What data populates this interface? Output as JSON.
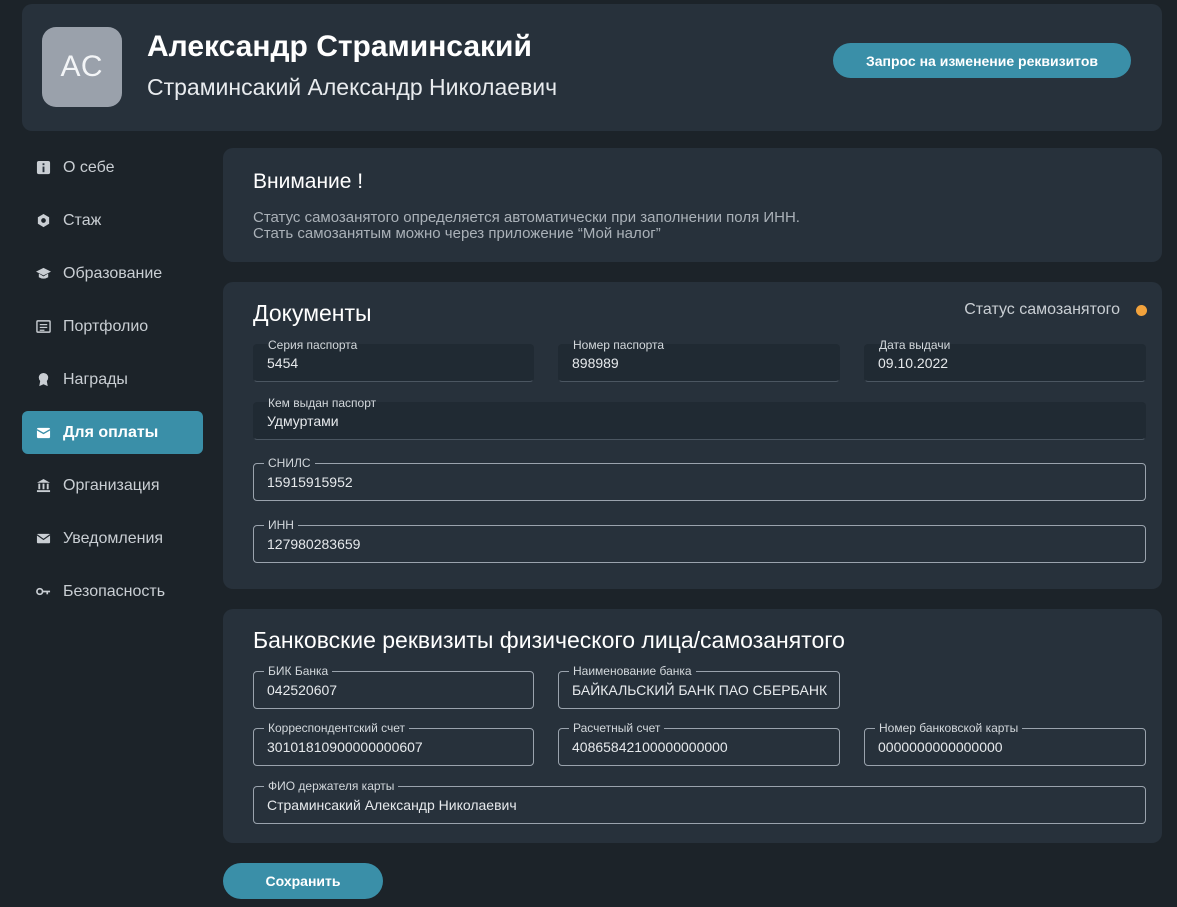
{
  "header": {
    "initials": "АС",
    "name": "Александр Страминсакий",
    "full_name": "Страминсакий Александр Николаевич",
    "request_button": "Запрос на изменение реквизитов"
  },
  "sidebar": {
    "items": [
      {
        "label": "О себе",
        "icon": "info-icon"
      },
      {
        "label": "Стаж",
        "icon": "hexagon-icon"
      },
      {
        "label": "Образование",
        "icon": "graduation-cap-icon"
      },
      {
        "label": "Портфолио",
        "icon": "document-icon"
      },
      {
        "label": "Награды",
        "icon": "award-icon"
      },
      {
        "label": "Для оплаты",
        "icon": "wallet-icon",
        "active": true
      },
      {
        "label": "Организация",
        "icon": "bank-icon"
      },
      {
        "label": "Уведомления",
        "icon": "envelope-icon"
      },
      {
        "label": "Безопасность",
        "icon": "key-icon"
      }
    ]
  },
  "notice": {
    "title": "Внимание !",
    "line1": "Статус самозанятого определяется автоматически при заполнении поля ИНН.",
    "line2": "Стать самозанятым можно через приложение “Мой налог”"
  },
  "documents": {
    "title": "Документы",
    "status_label": "Статус самозанятого",
    "status_color": "#f2a23c",
    "passport_series": {
      "label": "Серия паспорта",
      "value": "5454"
    },
    "passport_number": {
      "label": "Номер паспорта",
      "value": "898989"
    },
    "issue_date": {
      "label": "Дата выдачи",
      "value": "09.10.2022"
    },
    "issued_by": {
      "label": "Кем выдан паспорт",
      "value": "Удмуртами"
    },
    "snils": {
      "label": "СНИЛС",
      "value": "15915915952"
    },
    "inn": {
      "label": "ИНН",
      "value": "127980283659"
    }
  },
  "bank": {
    "title": "Банковские реквизиты физического лица/самозанятого",
    "bik": {
      "label": "БИК Банка",
      "value": "042520607"
    },
    "bank_name": {
      "label": "Наименование банка",
      "value": "БАЙКАЛЬСКИЙ БАНК ПАО СБЕРБАНК"
    },
    "corr_account": {
      "label": "Корреспондентский счет",
      "value": "30101810900000000607"
    },
    "settlement_account": {
      "label": "Расчетный счет",
      "value": "40865842100000000000"
    },
    "card_number": {
      "label": "Номер банковской карты",
      "value": "0000000000000000"
    },
    "card_holder": {
      "label": "ФИО держателя карты",
      "value": "Страминсакий Александр Николаевич"
    }
  },
  "save_button": "Сохранить",
  "colors": {
    "accent": "#3a8fa8",
    "background": "#1c2329",
    "panel": "#27313b"
  }
}
